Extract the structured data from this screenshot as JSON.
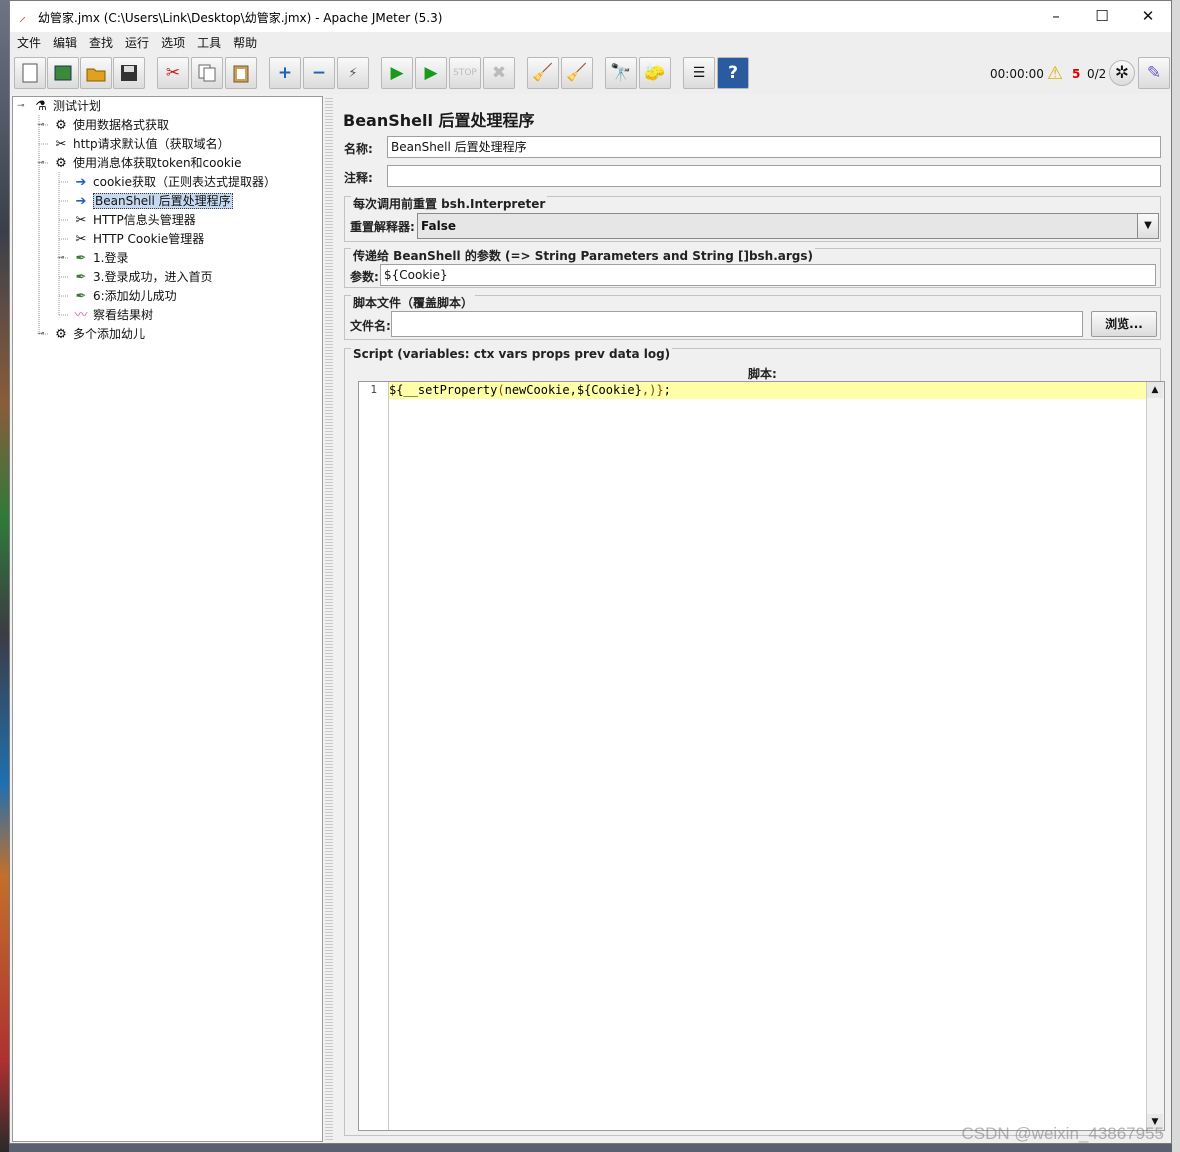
{
  "window": {
    "title": "幼管家.jmx (C:\\Users\\Link\\Desktop\\幼管家.jmx) - Apache JMeter (5.3)"
  },
  "menu": [
    "文件",
    "编辑",
    "查找",
    "运行",
    "选项",
    "工具",
    "帮助"
  ],
  "toolbar": {
    "timer": "00:00:00",
    "warnings": "5",
    "threads": "0/2"
  },
  "tree": [
    {
      "label": "测试计划",
      "icon": "test-plan-icon"
    },
    {
      "label": "使用数据格式获取",
      "icon": "gear-icon"
    },
    {
      "label": "http请求默认值（获取域名）",
      "icon": "wrench-icon"
    },
    {
      "label": "使用消息体获取token和cookie",
      "icon": "gear-icon"
    },
    {
      "label": "cookie获取（正则表达式提取器）",
      "icon": "post-processor-icon"
    },
    {
      "label": "BeanShell 后置处理程序",
      "icon": "post-processor-icon"
    },
    {
      "label": "HTTP信息头管理器",
      "icon": "wrench-icon"
    },
    {
      "label": "HTTP Cookie管理器",
      "icon": "wrench-icon"
    },
    {
      "label": "1.登录",
      "icon": "pipette-icon"
    },
    {
      "label": "3.登录成功，进入首页",
      "icon": "pipette-icon"
    },
    {
      "label": "6:添加幼儿成功",
      "icon": "pipette-icon"
    },
    {
      "label": "察看结果树",
      "icon": "graph-icon"
    },
    {
      "label": "多个添加幼儿",
      "icon": "gear-icon"
    }
  ],
  "panel": {
    "title": "BeanShell 后置处理程序",
    "name_label": "名称:",
    "name_value": "BeanShell 后置处理程序",
    "comment_label": "注释:",
    "comment_value": "",
    "reset_group": "每次调用前重置 bsh.Interpreter",
    "reset_label": "重置解释器:",
    "reset_value": "False",
    "params_group": "传递给 BeanShell 的参数 (=> String Parameters and String []bsh.args)",
    "params_label": "参数:",
    "params_value": "${Cookie}",
    "file_group": "脚本文件（覆盖脚本）",
    "file_label": "文件名:",
    "file_value": "",
    "browse_label": "浏览...",
    "script_group": "Script (variables: ctx vars props prev data log)",
    "script_label": "脚本:",
    "line_number": "1",
    "code_prefix": "${",
    "code_func": "__setProperty",
    "code_open": "(",
    "code_args1": "newCookie,",
    "code_var": "${Cookie}",
    "code_args2": ",",
    "code_close": ")}",
    "code_end": ";"
  },
  "watermark": "CSDN @weixin_43867955"
}
